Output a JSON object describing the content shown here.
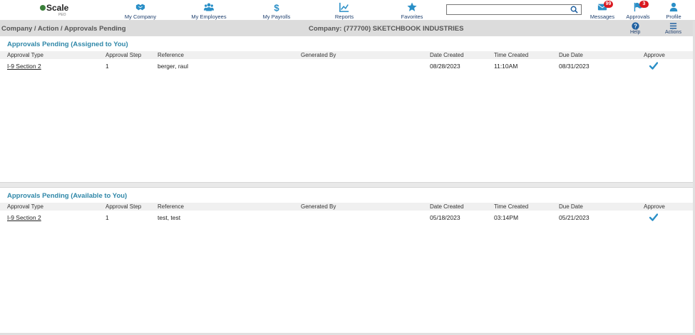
{
  "logo": {
    "name": "Scale",
    "sub": "PEO"
  },
  "nav": {
    "my_company": "My Company",
    "my_employees": "My Employees",
    "my_payrolls": "My Payrolls",
    "reports": "Reports",
    "favorites": "Favorites",
    "messages": "Messages",
    "messages_badge": "99",
    "approvals": "Approvals",
    "approvals_badge": "3",
    "profile": "Profile"
  },
  "search": {
    "value": "",
    "placeholder": ""
  },
  "header": {
    "breadcrumb": "Company / Action / Approvals Pending",
    "company": "Company: (777700) SKETCHBOOK INDUSTRIES",
    "help": "Help",
    "actions": "Actions"
  },
  "columns": {
    "approval_type": "Approval Type",
    "approval_step": "Approval Step",
    "reference": "Reference",
    "generated_by": "Generated By",
    "date_created": "Date Created",
    "time_created": "Time Created",
    "due_date": "Due Date",
    "approve": "Approve"
  },
  "assigned": {
    "title": "Approvals Pending (Assigned to You)",
    "rows": [
      {
        "approval_type": "I-9 Section 2",
        "approval_step": "1",
        "reference": "berger, raul",
        "generated_by": "",
        "date_created": "08/28/2023",
        "time_created": "11:10AM",
        "due_date": "08/31/2023"
      }
    ]
  },
  "available": {
    "title": "Approvals Pending (Available to You)",
    "rows": [
      {
        "approval_type": "I-9 Section 2",
        "approval_step": "1",
        "reference": "test, test",
        "generated_by": "",
        "date_created": "05/18/2023",
        "time_created": "03:14PM",
        "due_date": "05/21/2023"
      }
    ]
  },
  "colors": {
    "nav_icon": "#2a8fc7",
    "title": "#2f87a8",
    "badge": "#d9181f",
    "logo_dot": "#3b7f3a"
  },
  "icons": {
    "my_company": "handshake-icon",
    "my_employees": "users-icon",
    "my_payrolls": "dollar-icon",
    "reports": "chart-line-icon",
    "favorites": "star-icon",
    "messages": "envelope-icon",
    "approvals": "flag-icon",
    "profile": "user-icon",
    "help": "question-circle-icon",
    "actions": "hamburger-menu-icon",
    "refresh": "refresh-icon",
    "approve": "checkmark-icon"
  }
}
